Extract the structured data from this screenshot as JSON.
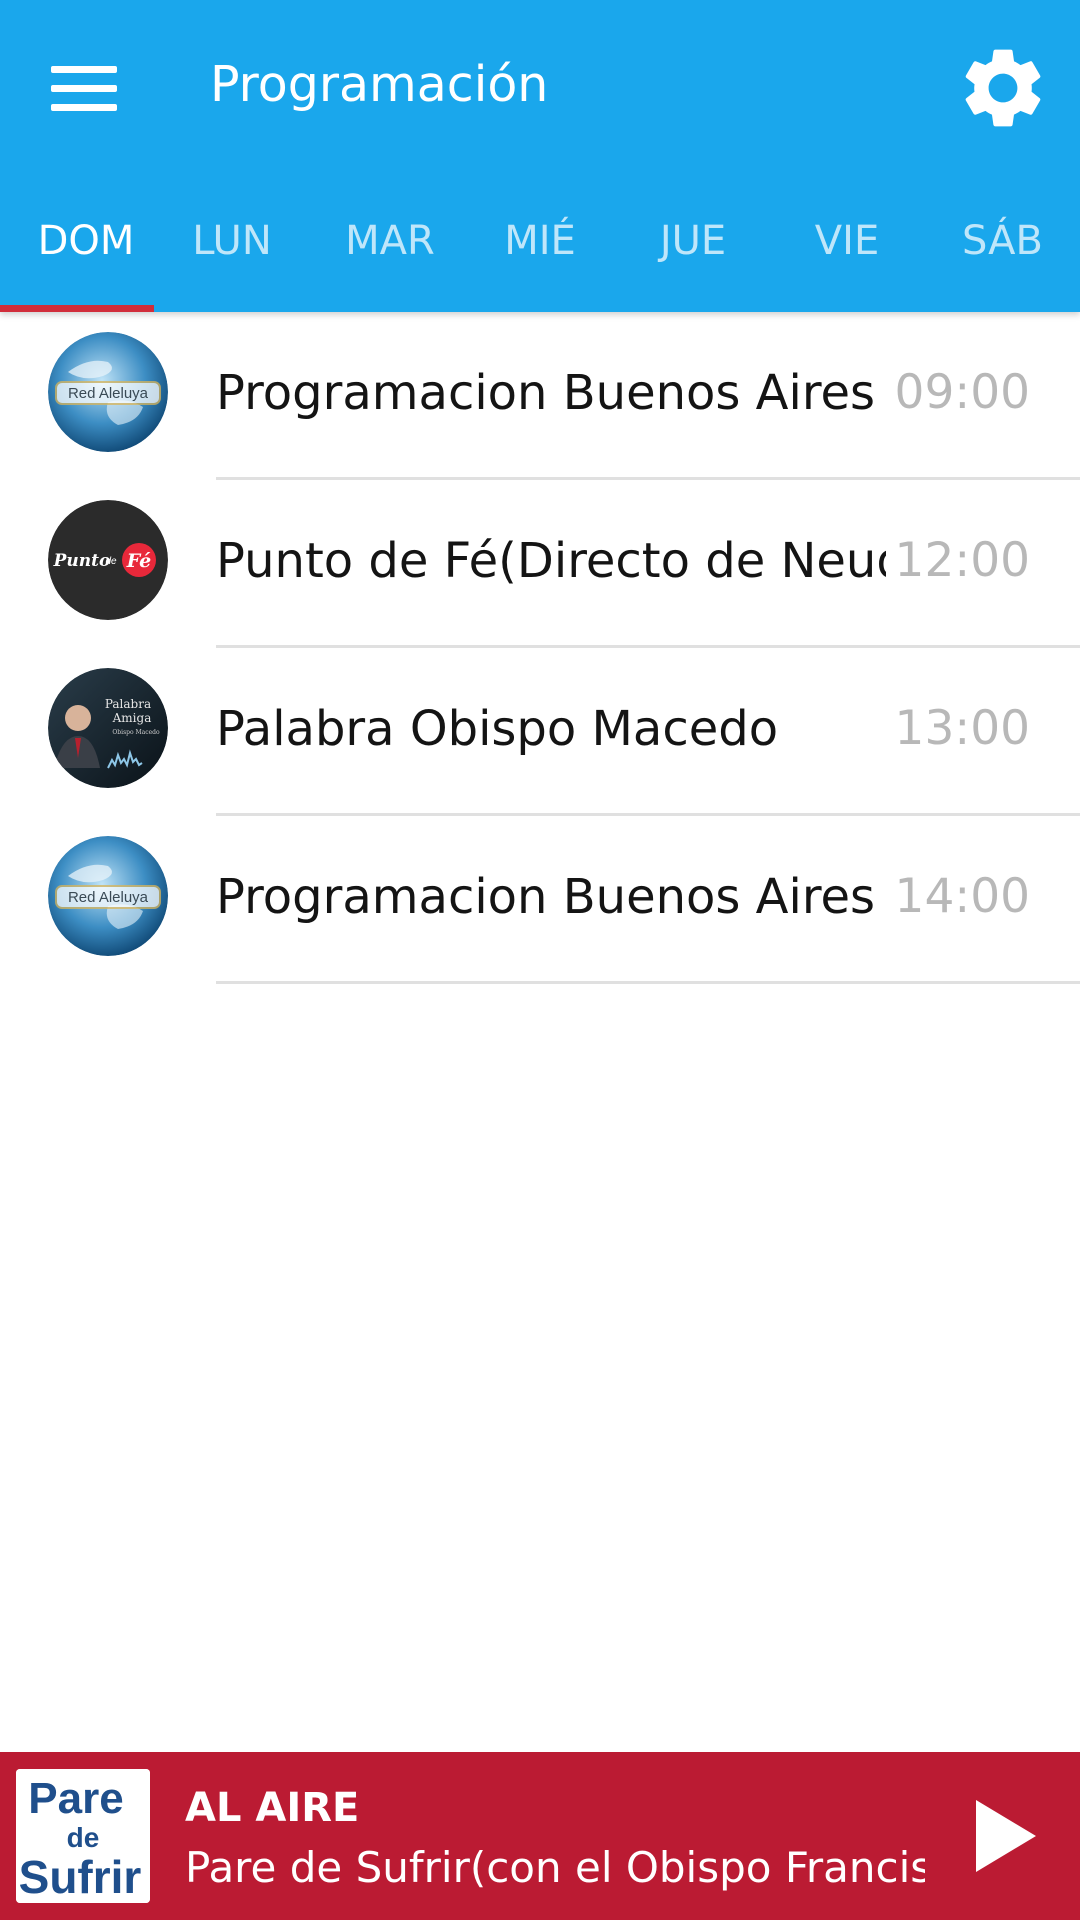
{
  "header": {
    "title": "Programación",
    "menu_icon": "hamburger-menu-icon",
    "settings_icon": "gear-icon",
    "background": "#1aa7ec"
  },
  "tabs": [
    {
      "label": "DOM",
      "active": true
    },
    {
      "label": "LUN",
      "active": false
    },
    {
      "label": "MAR",
      "active": false
    },
    {
      "label": "MIÉ",
      "active": false
    },
    {
      "label": "JUE",
      "active": false
    },
    {
      "label": "VIE",
      "active": false
    },
    {
      "label": "SÁB",
      "active": false
    }
  ],
  "schedule": [
    {
      "title": "Programacion Buenos Aires",
      "time": "09:00",
      "logo_text": "Red Aleluya"
    },
    {
      "title": "Punto de Fé(Directo de Neuquén)",
      "time": "12:00",
      "logo_text": "Punto de Fé"
    },
    {
      "title": "Palabra Obispo Macedo",
      "time": "13:00",
      "logo_text": "Palabra Amiga Obispo Macedo"
    },
    {
      "title": "Programacion Buenos Aires",
      "time": "14:00",
      "logo_text": "Red Aleluya"
    }
  ],
  "player": {
    "label": "AL AIRE",
    "track": "Pare de Sufrir(con el Obispo Francis...",
    "art_text": "Pare de Sufrir",
    "play_icon": "play-icon",
    "background": "#bb1b33"
  },
  "colors": {
    "accent": "#1aa7ec",
    "tab_indicator": "#d12d3a",
    "time_text": "#b8b8b8"
  }
}
